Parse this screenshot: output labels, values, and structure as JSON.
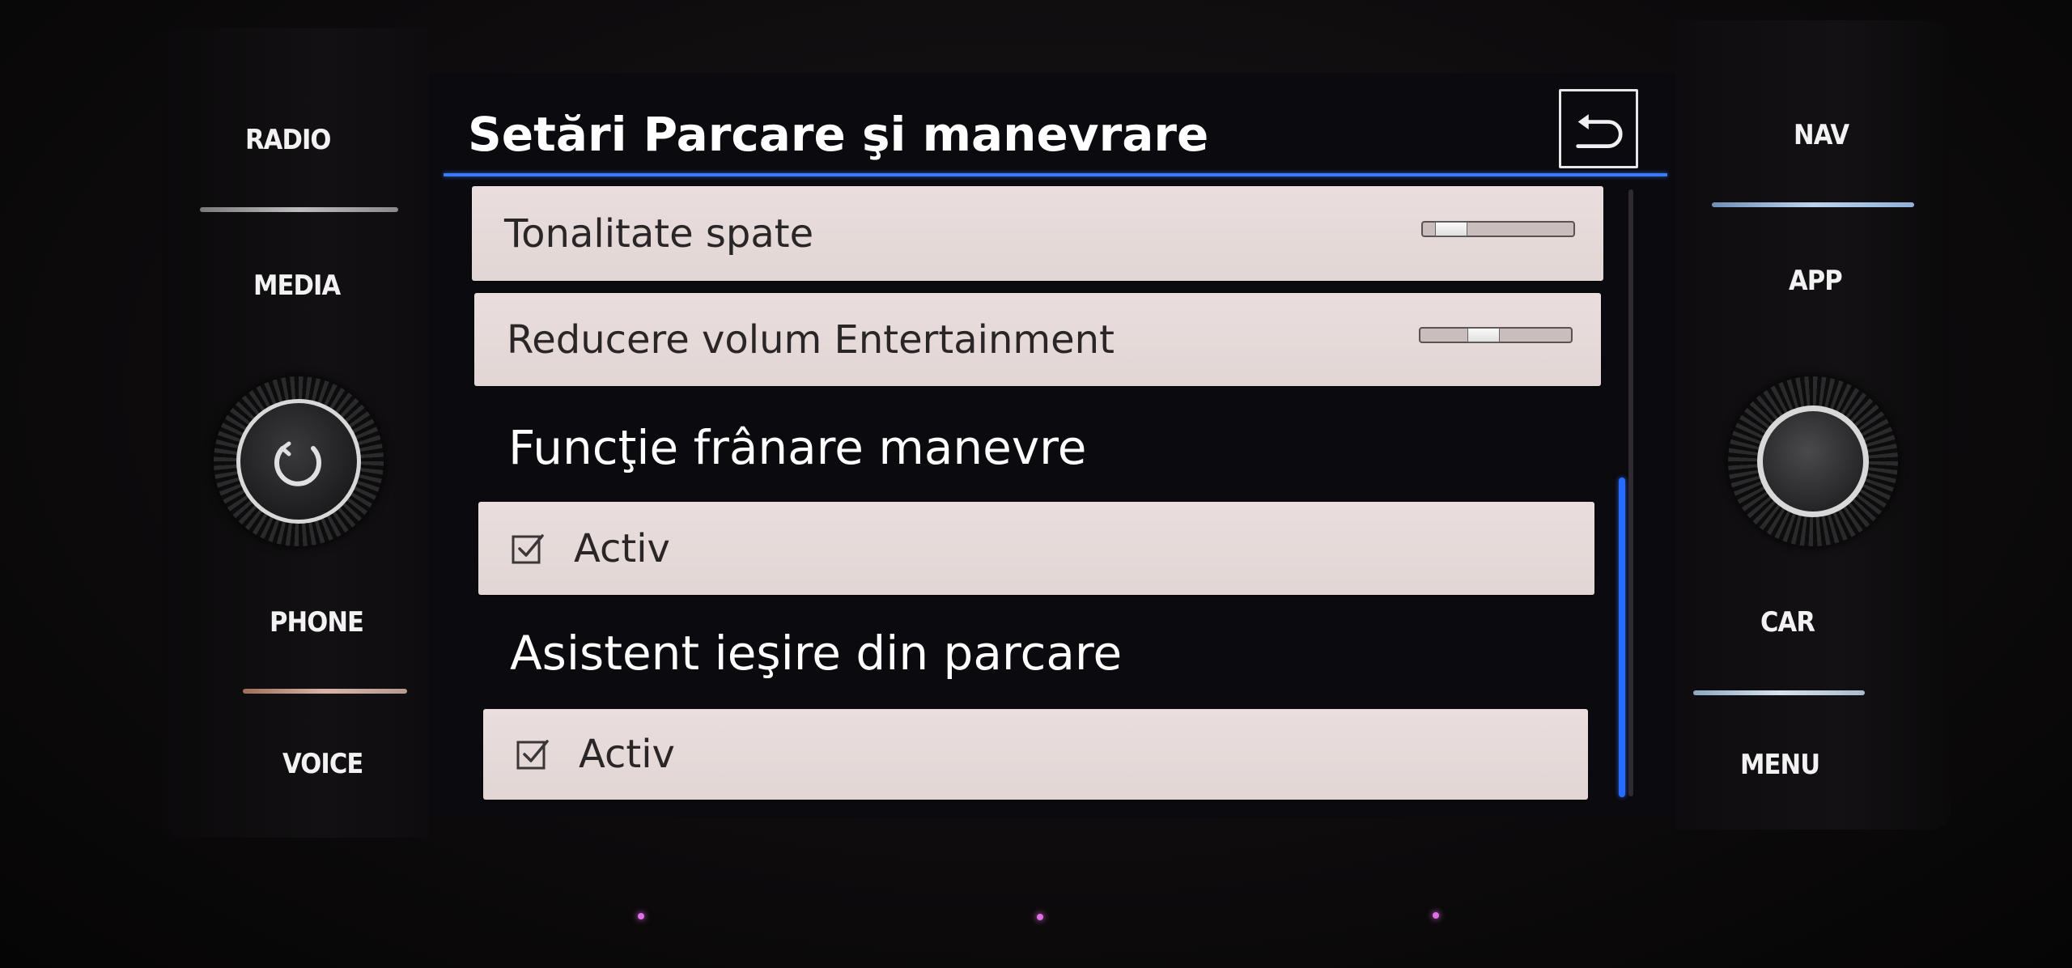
{
  "hardware_buttons": {
    "left": [
      {
        "label": "RADIO"
      },
      {
        "label": "MEDIA"
      },
      {
        "label": "PHONE"
      },
      {
        "label": "VOICE"
      }
    ],
    "right": [
      {
        "label": "NAV"
      },
      {
        "label": "APP"
      },
      {
        "label": "CAR"
      },
      {
        "label": "MENU"
      }
    ]
  },
  "header": {
    "title": "Setări Parcare şi manevrare",
    "back_icon": "back-arrow-icon"
  },
  "settings": {
    "rows": [
      {
        "label": "Tonalitate spate",
        "slider_value": 0.1
      },
      {
        "label": "Reducere volum Entertainment",
        "slider_value": 0.4
      }
    ],
    "sections": [
      {
        "title": "Funcţie frânare manevre",
        "option_label": "Activ",
        "checked": true
      },
      {
        "title": "Asistent ieşire din parcare",
        "option_label": "Activ",
        "checked": true
      }
    ]
  },
  "scrollbar": {
    "position": 0.55,
    "visible_fraction": 0.55
  },
  "colors": {
    "accent_blue": "#3b7bff",
    "row_background": "#e6dadb",
    "text_light": "#ffffff",
    "text_dark": "#2a2628"
  }
}
